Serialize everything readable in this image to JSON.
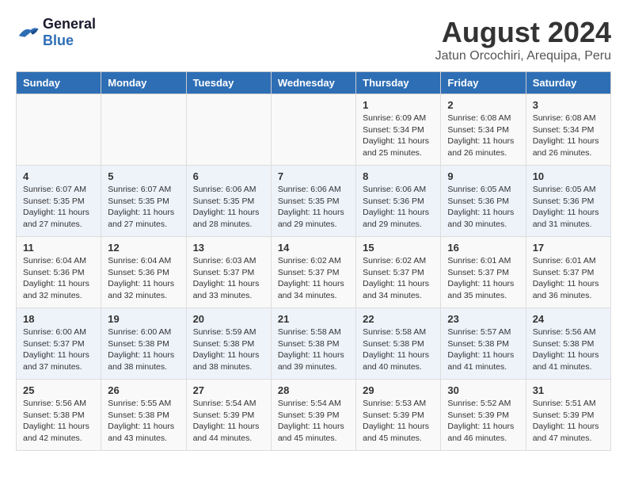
{
  "header": {
    "logo_text_general": "General",
    "logo_text_blue": "Blue",
    "main_title": "August 2024",
    "subtitle": "Jatun Orcochiri, Arequipa, Peru"
  },
  "days_of_week": [
    "Sunday",
    "Monday",
    "Tuesday",
    "Wednesday",
    "Thursday",
    "Friday",
    "Saturday"
  ],
  "weeks": [
    {
      "cells": [
        {
          "day": "",
          "info": ""
        },
        {
          "day": "",
          "info": ""
        },
        {
          "day": "",
          "info": ""
        },
        {
          "day": "",
          "info": ""
        },
        {
          "day": "1",
          "info": "Sunrise: 6:09 AM\nSunset: 5:34 PM\nDaylight: 11 hours\nand 25 minutes."
        },
        {
          "day": "2",
          "info": "Sunrise: 6:08 AM\nSunset: 5:34 PM\nDaylight: 11 hours\nand 26 minutes."
        },
        {
          "day": "3",
          "info": "Sunrise: 6:08 AM\nSunset: 5:34 PM\nDaylight: 11 hours\nand 26 minutes."
        }
      ]
    },
    {
      "cells": [
        {
          "day": "4",
          "info": "Sunrise: 6:07 AM\nSunset: 5:35 PM\nDaylight: 11 hours\nand 27 minutes."
        },
        {
          "day": "5",
          "info": "Sunrise: 6:07 AM\nSunset: 5:35 PM\nDaylight: 11 hours\nand 27 minutes."
        },
        {
          "day": "6",
          "info": "Sunrise: 6:06 AM\nSunset: 5:35 PM\nDaylight: 11 hours\nand 28 minutes."
        },
        {
          "day": "7",
          "info": "Sunrise: 6:06 AM\nSunset: 5:35 PM\nDaylight: 11 hours\nand 29 minutes."
        },
        {
          "day": "8",
          "info": "Sunrise: 6:06 AM\nSunset: 5:36 PM\nDaylight: 11 hours\nand 29 minutes."
        },
        {
          "day": "9",
          "info": "Sunrise: 6:05 AM\nSunset: 5:36 PM\nDaylight: 11 hours\nand 30 minutes."
        },
        {
          "day": "10",
          "info": "Sunrise: 6:05 AM\nSunset: 5:36 PM\nDaylight: 11 hours\nand 31 minutes."
        }
      ]
    },
    {
      "cells": [
        {
          "day": "11",
          "info": "Sunrise: 6:04 AM\nSunset: 5:36 PM\nDaylight: 11 hours\nand 32 minutes."
        },
        {
          "day": "12",
          "info": "Sunrise: 6:04 AM\nSunset: 5:36 PM\nDaylight: 11 hours\nand 32 minutes."
        },
        {
          "day": "13",
          "info": "Sunrise: 6:03 AM\nSunset: 5:37 PM\nDaylight: 11 hours\nand 33 minutes."
        },
        {
          "day": "14",
          "info": "Sunrise: 6:02 AM\nSunset: 5:37 PM\nDaylight: 11 hours\nand 34 minutes."
        },
        {
          "day": "15",
          "info": "Sunrise: 6:02 AM\nSunset: 5:37 PM\nDaylight: 11 hours\nand 34 minutes."
        },
        {
          "day": "16",
          "info": "Sunrise: 6:01 AM\nSunset: 5:37 PM\nDaylight: 11 hours\nand 35 minutes."
        },
        {
          "day": "17",
          "info": "Sunrise: 6:01 AM\nSunset: 5:37 PM\nDaylight: 11 hours\nand 36 minutes."
        }
      ]
    },
    {
      "cells": [
        {
          "day": "18",
          "info": "Sunrise: 6:00 AM\nSunset: 5:37 PM\nDaylight: 11 hours\nand 37 minutes."
        },
        {
          "day": "19",
          "info": "Sunrise: 6:00 AM\nSunset: 5:38 PM\nDaylight: 11 hours\nand 38 minutes."
        },
        {
          "day": "20",
          "info": "Sunrise: 5:59 AM\nSunset: 5:38 PM\nDaylight: 11 hours\nand 38 minutes."
        },
        {
          "day": "21",
          "info": "Sunrise: 5:58 AM\nSunset: 5:38 PM\nDaylight: 11 hours\nand 39 minutes."
        },
        {
          "day": "22",
          "info": "Sunrise: 5:58 AM\nSunset: 5:38 PM\nDaylight: 11 hours\nand 40 minutes."
        },
        {
          "day": "23",
          "info": "Sunrise: 5:57 AM\nSunset: 5:38 PM\nDaylight: 11 hours\nand 41 minutes."
        },
        {
          "day": "24",
          "info": "Sunrise: 5:56 AM\nSunset: 5:38 PM\nDaylight: 11 hours\nand 41 minutes."
        }
      ]
    },
    {
      "cells": [
        {
          "day": "25",
          "info": "Sunrise: 5:56 AM\nSunset: 5:38 PM\nDaylight: 11 hours\nand 42 minutes."
        },
        {
          "day": "26",
          "info": "Sunrise: 5:55 AM\nSunset: 5:38 PM\nDaylight: 11 hours\nand 43 minutes."
        },
        {
          "day": "27",
          "info": "Sunrise: 5:54 AM\nSunset: 5:39 PM\nDaylight: 11 hours\nand 44 minutes."
        },
        {
          "day": "28",
          "info": "Sunrise: 5:54 AM\nSunset: 5:39 PM\nDaylight: 11 hours\nand 45 minutes."
        },
        {
          "day": "29",
          "info": "Sunrise: 5:53 AM\nSunset: 5:39 PM\nDaylight: 11 hours\nand 45 minutes."
        },
        {
          "day": "30",
          "info": "Sunrise: 5:52 AM\nSunset: 5:39 PM\nDaylight: 11 hours\nand 46 minutes."
        },
        {
          "day": "31",
          "info": "Sunrise: 5:51 AM\nSunset: 5:39 PM\nDaylight: 11 hours\nand 47 minutes."
        }
      ]
    }
  ]
}
